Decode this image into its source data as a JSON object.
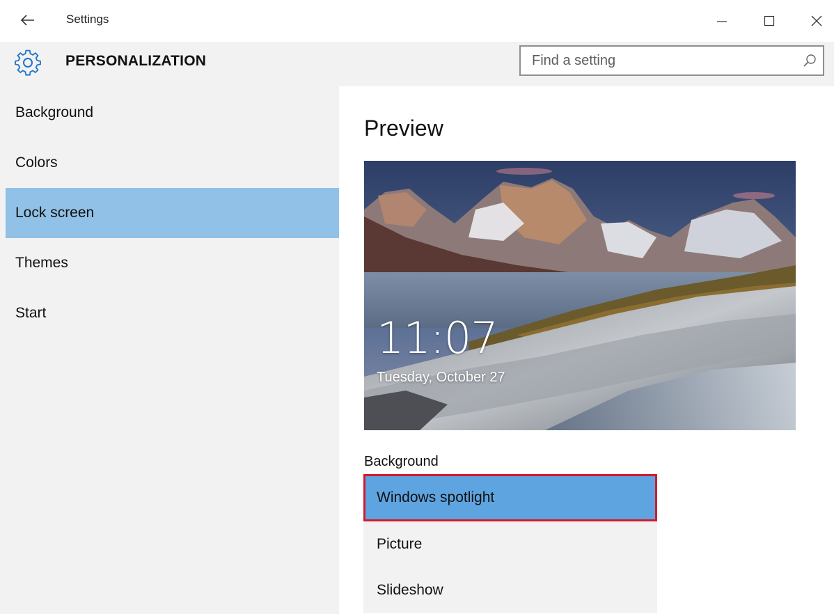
{
  "window": {
    "title": "Settings",
    "back_icon": "arrow-left-icon",
    "controls": [
      "minimize-icon",
      "maximize-icon",
      "close-icon"
    ]
  },
  "header": {
    "title": "PERSONALIZATION",
    "icon": "gear-icon",
    "search": {
      "placeholder": "Find a setting",
      "value": "",
      "icon": "search-icon"
    }
  },
  "sidebar": {
    "items": [
      {
        "label": "Background",
        "selected": false
      },
      {
        "label": "Colors",
        "selected": false
      },
      {
        "label": "Lock screen",
        "selected": true
      },
      {
        "label": "Themes",
        "selected": false
      },
      {
        "label": "Start",
        "selected": false
      }
    ]
  },
  "main": {
    "preview_title": "Preview",
    "preview": {
      "time": "11:07",
      "date": "Tuesday, October 27"
    },
    "background": {
      "label": "Background",
      "options": [
        {
          "label": "Windows spotlight",
          "selected": true
        },
        {
          "label": "Picture",
          "selected": false
        },
        {
          "label": "Slideshow",
          "selected": false
        }
      ]
    }
  },
  "colors": {
    "selected_nav": "#91c1e6",
    "selected_option": "#5ea4e0",
    "highlight_border": "#d21a2d",
    "panel_bg": "#f2f2f2"
  }
}
